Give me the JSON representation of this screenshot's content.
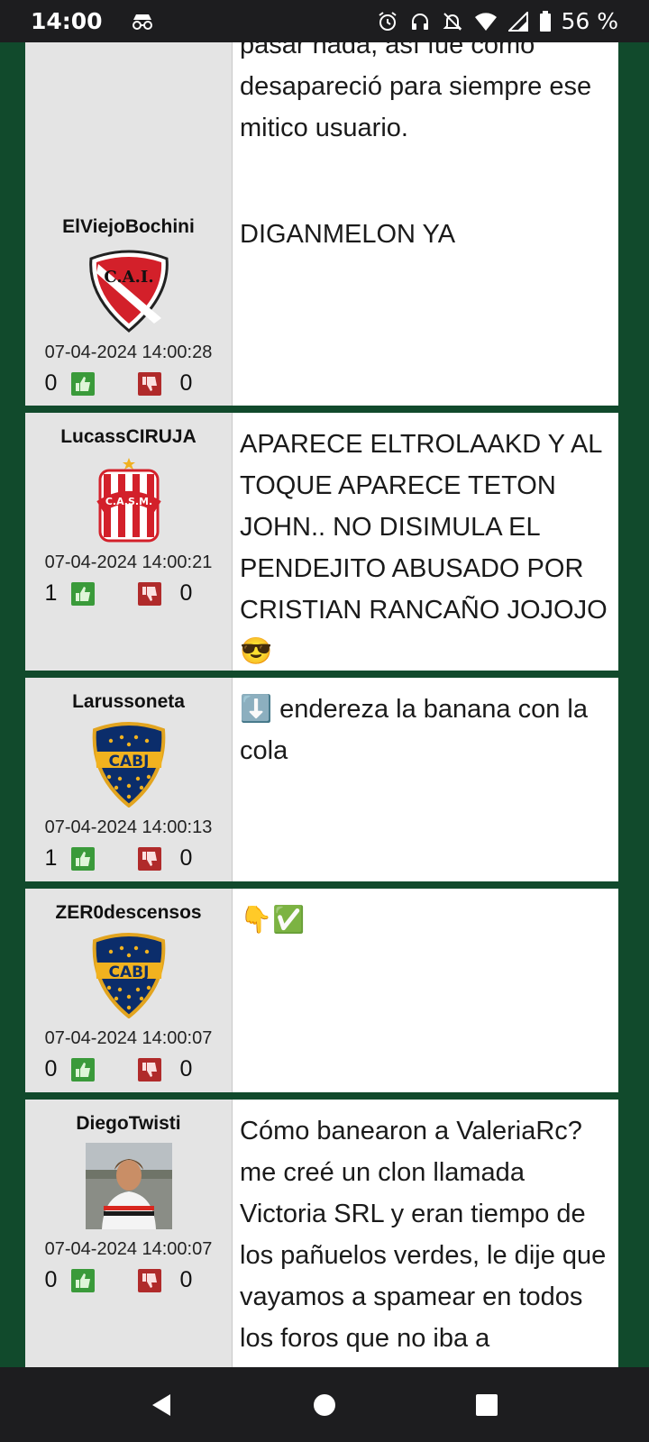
{
  "status": {
    "time": "14:00",
    "battery": "56 %"
  },
  "posts": [
    {
      "username": "",
      "date": "",
      "likes": "",
      "dislikes": "",
      "text": "pasar nada, así fue como desapareció para siempre ese mitico usuario."
    },
    {
      "username": "ElViejoBochini",
      "badge": "CAI",
      "date": "07-04-2024 14:00:28",
      "likes": "0",
      "dislikes": "0",
      "text": "DIGANMELON YA"
    },
    {
      "username": "LucassCIRUJA",
      "badge": "CASM",
      "date": "07-04-2024 14:00:21",
      "likes": "1",
      "dislikes": "0",
      "text": "APARECE ELTROLAAKD Y AL TOQUE APARECE TETON JOHN.. NO DISIMULA EL PENDEJITO ABUSADO POR CRISTIAN RANCAÑO JOJOJO 😎"
    },
    {
      "username": "Larussoneta",
      "badge": "CABJ",
      "date": "07-04-2024 14:00:13",
      "likes": "1",
      "dislikes": "0",
      "text": "⬇️ endereza la banana con la cola"
    },
    {
      "username": "ZER0descensos",
      "badge": "CABJ",
      "date": "07-04-2024 14:00:07",
      "likes": "0",
      "dislikes": "0",
      "text": "👇✅"
    },
    {
      "username": "DiegoTwisti",
      "badge": "photo",
      "date": "07-04-2024 14:00:07",
      "likes": "0",
      "dislikes": "0",
      "text": "Cómo banearon a ValeriaRc? me creé un clon llamada Victoria SRL y eran tiempo de los pañuelos verdes, le dije que vayamos a spamear en todos los foros que no iba a"
    }
  ],
  "colors": {
    "forum_bg": "#114a2c",
    "user_panel": "#e4e4e4",
    "like": "#3a9a3a",
    "dislike": "#b02a2a"
  }
}
